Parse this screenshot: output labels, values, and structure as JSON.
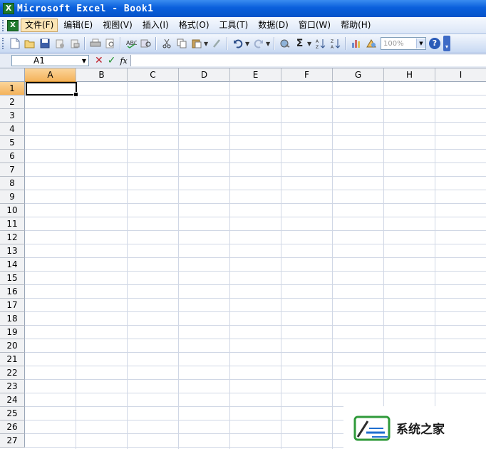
{
  "window": {
    "title": "Microsoft Excel - Book1",
    "app_icon": "excel-icon"
  },
  "menu": {
    "items": [
      {
        "label": "文件(F)",
        "active": true
      },
      {
        "label": "编辑(E)"
      },
      {
        "label": "视图(V)"
      },
      {
        "label": "插入(I)"
      },
      {
        "label": "格式(O)"
      },
      {
        "label": "工具(T)"
      },
      {
        "label": "数据(D)"
      },
      {
        "label": "窗口(W)"
      },
      {
        "label": "帮助(H)"
      }
    ]
  },
  "toolbar": {
    "icons": [
      "new-icon",
      "open-icon",
      "save-icon",
      "permission-icon",
      "email-icon",
      "print-icon",
      "print-preview-icon",
      "spelling-icon",
      "research-icon",
      "cut-icon",
      "copy-icon",
      "paste-icon",
      "format-painter-icon",
      "undo-icon",
      "redo-icon",
      "hyperlink-icon",
      "autosum-icon",
      "sort-ascending-icon",
      "sort-descending-icon",
      "chart-wizard-icon",
      "drawing-icon"
    ],
    "zoom_value": "100%",
    "help_icon": "help-icon"
  },
  "formula_bar": {
    "name_box": "A1",
    "formula": ""
  },
  "sheet": {
    "columns": [
      "A",
      "B",
      "C",
      "D",
      "E",
      "F",
      "G",
      "H",
      "I"
    ],
    "rows": [
      "1",
      "2",
      "3",
      "4",
      "5",
      "6",
      "7",
      "8",
      "9",
      "10",
      "11",
      "12",
      "13",
      "14",
      "15",
      "16",
      "17",
      "18",
      "19",
      "20",
      "21",
      "22",
      "23",
      "24",
      "25",
      "26",
      "27"
    ],
    "active_cell": "A1"
  },
  "watermark": {
    "text": "系统之家"
  },
  "colors": {
    "title_bar": "#0a5fdc",
    "selected_header": "#f4b25a",
    "gridline": "#d0d7e5"
  }
}
